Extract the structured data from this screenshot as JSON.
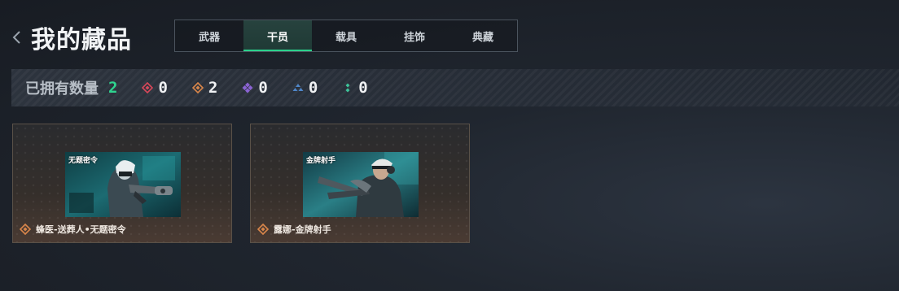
{
  "header": {
    "title": "我的藏品"
  },
  "tabs": [
    {
      "label": "武器",
      "active": false
    },
    {
      "label": "干员",
      "active": true
    },
    {
      "label": "载具",
      "active": false
    },
    {
      "label": "挂饰",
      "active": false
    },
    {
      "label": "典藏",
      "active": false
    }
  ],
  "stats": {
    "label": "已拥有数量",
    "total": "2",
    "rarities": [
      {
        "icon": "red-diamond-icon",
        "color": "#d8485a",
        "count": "0"
      },
      {
        "icon": "orange-diamond-icon",
        "color": "#d9864a",
        "count": "2"
      },
      {
        "icon": "purple-diamond-icon",
        "color": "#8a63d2",
        "count": "0"
      },
      {
        "icon": "blue-triangle-icon",
        "color": "#4f86c9",
        "count": "0"
      },
      {
        "icon": "green-dots-icon",
        "color": "#3ec49a",
        "count": "0"
      }
    ]
  },
  "collection": {
    "items": [
      {
        "name": "蜂医-送葬人•无题密令",
        "image_caption": "无题密令",
        "rarity_color": "#d9864a"
      },
      {
        "name": "露娜-金牌射手",
        "image_caption": "金牌射手",
        "rarity_color": "#d9864a"
      }
    ]
  }
}
